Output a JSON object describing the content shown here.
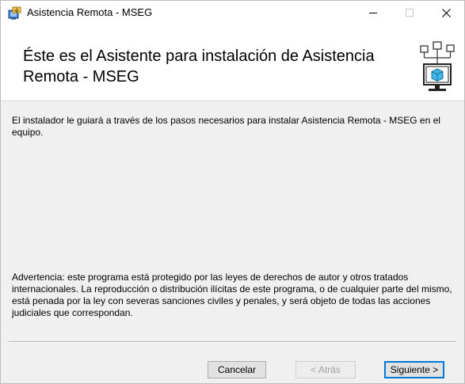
{
  "window": {
    "title": "Asistencia Remota - MSEG",
    "controls": {
      "minimize": "—",
      "maximize": "□",
      "close": "✕"
    }
  },
  "banner": {
    "heading": "Éste es el Asistente para instalación de Asistencia Remota - MSEG"
  },
  "body": {
    "intro": "El instalador le guiará a través de los pasos necesarios para instalar Asistencia Remota - MSEG en el equipo.",
    "warning": "Advertencia: este programa está protegido por las leyes de derechos de autor y otros tratados internacionales. La reproducción o distribución ilícitas de este programa, o de cualquier parte del mismo, está penada por la ley con severas sanciones civiles y penales, y será objeto de todas las acciones judiciales que correspondan."
  },
  "buttons": {
    "cancel": "Cancelar",
    "back": "< Atrás",
    "next": "Siguiente >"
  },
  "icons": {
    "app": "installer-icon",
    "banner": "computer-network-box-icon"
  },
  "colors": {
    "accent": "#0078d7",
    "panel": "#f0f0f0",
    "disabled_text": "#a0a0a0"
  }
}
